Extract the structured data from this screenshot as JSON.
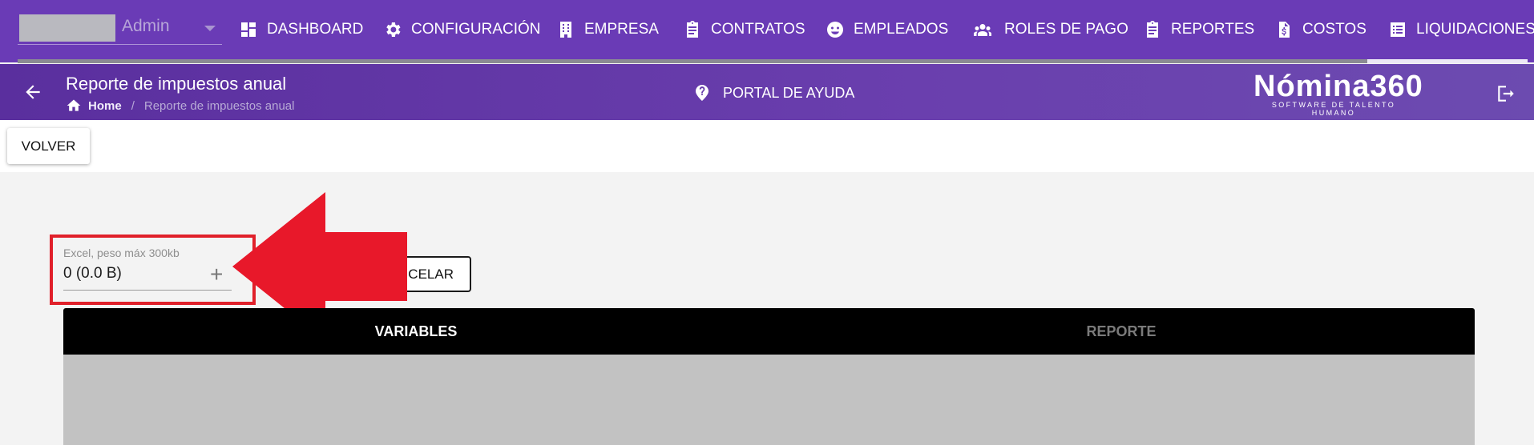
{
  "topbar": {
    "company_name": "Admin",
    "nav": [
      {
        "label": "DASHBOARD",
        "icon": "dashboard-icon"
      },
      {
        "label": "CONFIGURACIÓN",
        "icon": "gear-icon"
      },
      {
        "label": "EMPRESA",
        "icon": "building-icon"
      },
      {
        "label": "CONTRATOS",
        "icon": "clipboard-icon"
      },
      {
        "label": "EMPLEADOS",
        "icon": "face-icon"
      },
      {
        "label": "ROLES DE PAGO",
        "icon": "people-icon"
      },
      {
        "label": "REPORTES",
        "icon": "clipboard-icon"
      },
      {
        "label": "COSTOS",
        "icon": "invoice-icon"
      },
      {
        "label": "LIQUIDACIONES",
        "icon": "list-icon"
      }
    ]
  },
  "header": {
    "title": "Reporte de impuestos anual",
    "breadcrumb": {
      "home": "Home",
      "current": "Reporte de impuestos anual"
    },
    "help_label": "PORTAL DE AYUDA",
    "brand": {
      "name": "Nómina360",
      "tagline": "SOFTWARE DE TALENTO HUMANO"
    }
  },
  "toolbar": {
    "back_label": "VOLVER"
  },
  "upload": {
    "label": "Excel, peso máx 300kb",
    "value": "0 (0.0 B)"
  },
  "cancel_label": "CANCELAR",
  "tabs": [
    {
      "label": "VARIABLES",
      "active": true
    },
    {
      "label": "REPORTE",
      "active": false
    }
  ],
  "colors": {
    "primary": "#6a3bb6",
    "annotation": "#e0202a"
  }
}
